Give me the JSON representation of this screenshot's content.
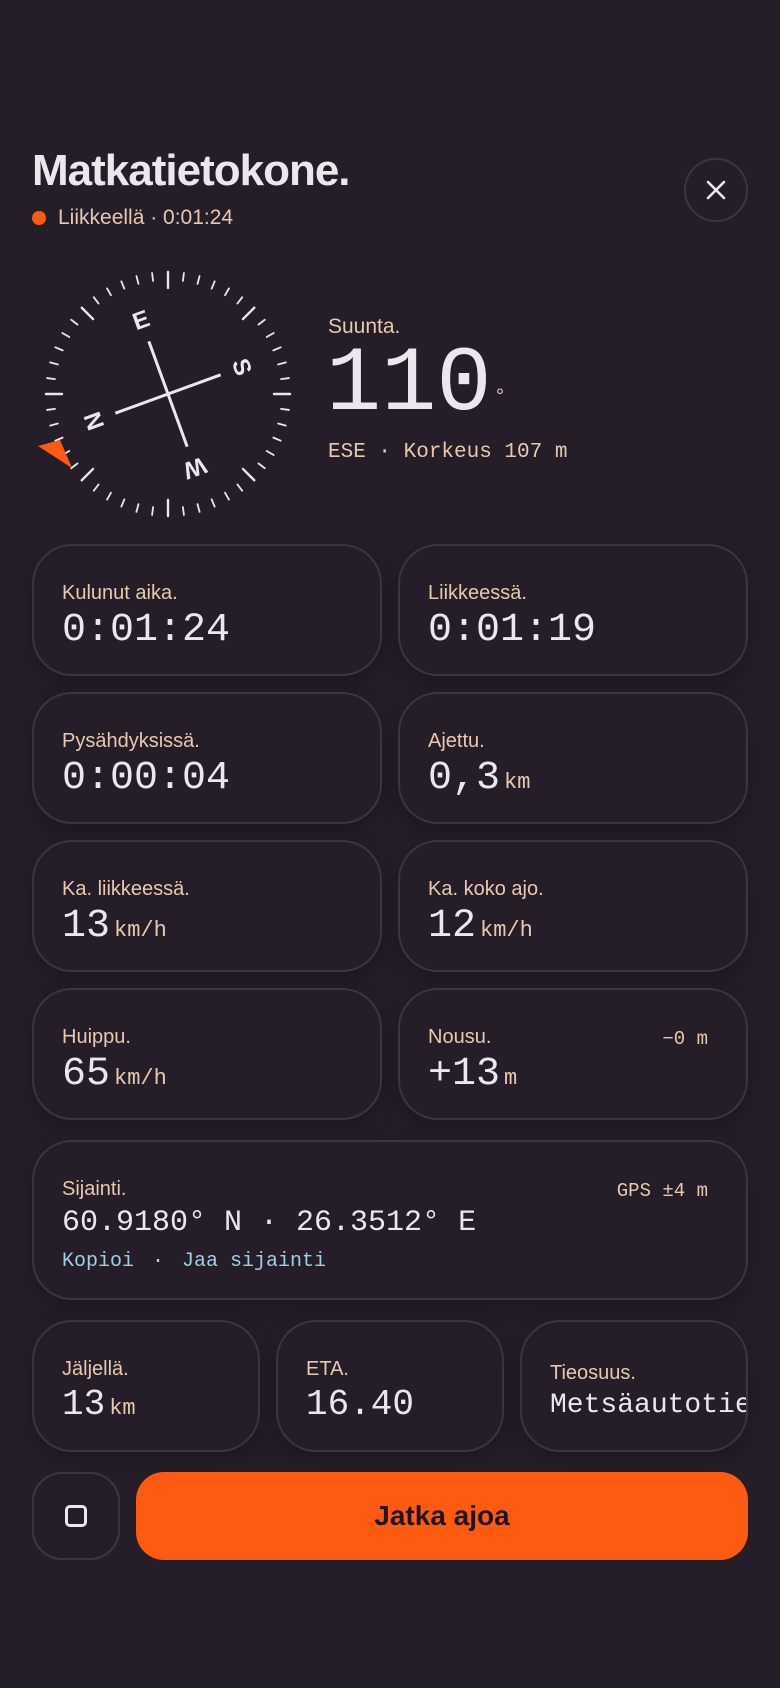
{
  "header": {
    "title": "Matkatietokone.",
    "status": "Liikkeellä · 0:01:24",
    "status_color": "#ff5a12"
  },
  "compass": {
    "heading_label": "Suunta.",
    "heading_value": "110",
    "degree_symbol": "°",
    "subtitle": "ESE · Korkeus 107 m",
    "letters": {
      "north": "N",
      "east": "E",
      "south": "S",
      "west": "W"
    },
    "heading_degrees": 110
  },
  "stats": {
    "elapsed": {
      "label": "Kulunut aika.",
      "value": "0:01:24"
    },
    "moving": {
      "label": "Liikkeessä.",
      "value": "0:01:19"
    },
    "stopped": {
      "label": "Pysähdyksissä.",
      "value": "0:00:04"
    },
    "distance": {
      "label": "Ajettu.",
      "value": "0,3",
      "unit": "km"
    },
    "avg_moving": {
      "label": "Ka. liikkeessä.",
      "value": "13",
      "unit": "km/h"
    },
    "avg_total": {
      "label": "Ka. koko ajo.",
      "value": "12",
      "unit": "km/h"
    },
    "top_speed": {
      "label": "Huippu.",
      "value": "65",
      "unit": "km/h"
    },
    "climb": {
      "label": "Nousu.",
      "value": "+13",
      "unit": "m",
      "descent": "−0 m"
    }
  },
  "location": {
    "label": "Sijainti.",
    "accuracy": "GPS ±4 m",
    "coords": "60.9180° N · 26.3512° E",
    "copy_label": "Kopioi",
    "separator": "·",
    "share_label": "Jaa sijainti"
  },
  "route": {
    "remaining": {
      "label": "Jäljellä.",
      "value": "13",
      "unit": "km"
    },
    "eta": {
      "label": "ETA.",
      "value": "16.40"
    },
    "road": {
      "label": "Tieosuus.",
      "value": "Metsäautotie"
    }
  },
  "actions": {
    "continue_label": "Jatka ajoa",
    "accent_color": "#ff5a12"
  }
}
